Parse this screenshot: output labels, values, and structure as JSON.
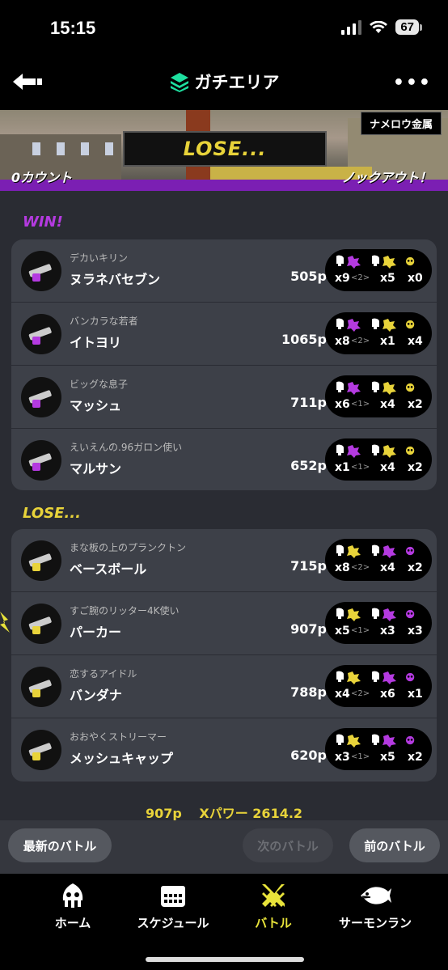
{
  "status": {
    "time": "15:15",
    "battery": "67"
  },
  "header": {
    "title": "ガチエリア"
  },
  "banner": {
    "stage": "ナメロウ金属",
    "result": "LOSE...",
    "count_left": "0カウント",
    "count_right": "ノックアウト！"
  },
  "win_team": {
    "label": "WIN!",
    "players": [
      {
        "title": "デカいキリン",
        "name": "ヌラネバセブン",
        "points": "505p",
        "stats": {
          "kills": "x9",
          "assists": "<2>",
          "specials": "x5",
          "third": "x0"
        }
      },
      {
        "title": "バンカラな若者",
        "name": "イトヨリ",
        "points": "1065p",
        "stats": {
          "kills": "x8",
          "assists": "<2>",
          "specials": "x1",
          "third": "x4"
        }
      },
      {
        "title": "ビッグな息子",
        "name": "マッシュ",
        "points": "711p",
        "stats": {
          "kills": "x6",
          "assists": "<1>",
          "specials": "x4",
          "third": "x2"
        }
      },
      {
        "title": "えいえんの.96ガロン使い",
        "name": "マルサン",
        "points": "652p",
        "stats": {
          "kills": "x1",
          "assists": "<1>",
          "specials": "x4",
          "third": "x2"
        }
      }
    ]
  },
  "lose_team": {
    "label": "LOSE...",
    "players": [
      {
        "title": "まな板の上のプランクトン",
        "name": "ベースボール",
        "points": "715p",
        "stats": {
          "kills": "x8",
          "assists": "<2>",
          "specials": "x4",
          "third": "x2"
        }
      },
      {
        "title": "すご腕のリッター4K使い",
        "name": "パーカー",
        "points": "907p",
        "stats": {
          "kills": "x5",
          "assists": "<1>",
          "specials": "x3",
          "third": "x3"
        }
      },
      {
        "title": "恋するアイドル",
        "name": "バンダナ",
        "points": "788p",
        "stats": {
          "kills": "x4",
          "assists": "<2>",
          "specials": "x6",
          "third": "x1"
        }
      },
      {
        "title": "おおやくストリーマー",
        "name": "メッシュキャップ",
        "points": "620p",
        "stats": {
          "kills": "x3",
          "assists": "<1>",
          "specials": "x5",
          "third": "x2"
        }
      }
    ]
  },
  "footer": {
    "points": "907p",
    "power": "Xパワー 2614.2"
  },
  "buttons": {
    "latest": "最新のバトル",
    "next": "次のバトル",
    "prev": "前のバトル"
  },
  "tabs": [
    {
      "label": "ホーム",
      "icon": "squid-icon"
    },
    {
      "label": "スケジュール",
      "icon": "calendar-icon"
    },
    {
      "label": "バトル",
      "icon": "battle-icon"
    },
    {
      "label": "サーモンラン",
      "icon": "salmon-icon"
    }
  ],
  "colors": {
    "win": "#b43ae0",
    "lose": "#e8d33a",
    "active_tab": "#e8e33a",
    "accent_green": "#1ee0a0"
  }
}
